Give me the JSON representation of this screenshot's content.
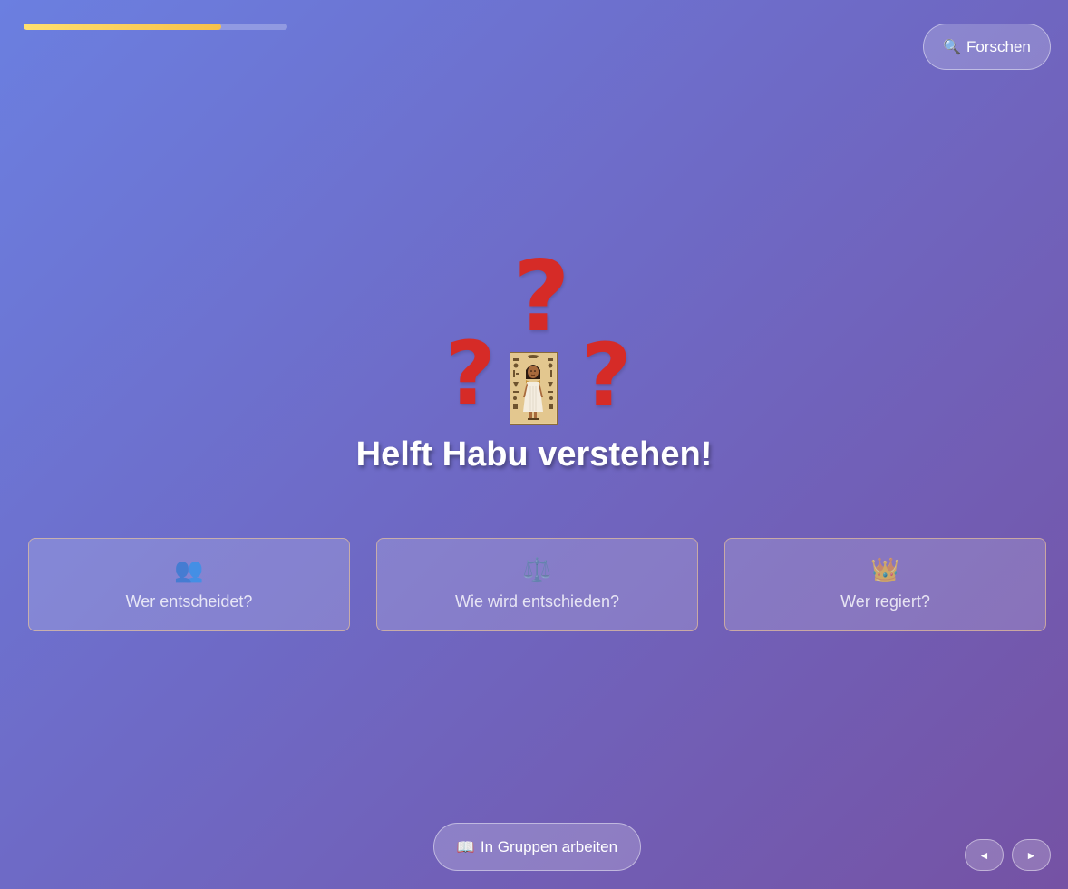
{
  "progress": {
    "fraction": 0.75,
    "track_color": "#ffffff",
    "fill_color": "#f7c04a"
  },
  "header": {
    "research_icon": "🔍",
    "research_label": "Forschen"
  },
  "hero": {
    "question_mark": "?",
    "question_mark_color": "#d62b27",
    "image": "habu-egyptian-child-card",
    "title": "Helft Habu verstehen!"
  },
  "cards": [
    {
      "icon": "👥",
      "icon_name": "people-icon",
      "label": "Wer entscheidet?"
    },
    {
      "icon": "⚖️",
      "icon_name": "scales-icon",
      "label": "Wie wird entschieden?"
    },
    {
      "icon": "👑",
      "icon_name": "crown-icon",
      "label": "Wer regiert?"
    }
  ],
  "footer": {
    "groups_icon": "📖",
    "groups_label": "In Gruppen arbeiten",
    "prev_icon": "◄",
    "next_icon": "►"
  },
  "colors": {
    "background_start": "#6b7fe0",
    "background_end": "#7552a4",
    "accent": "#f7c04a"
  }
}
